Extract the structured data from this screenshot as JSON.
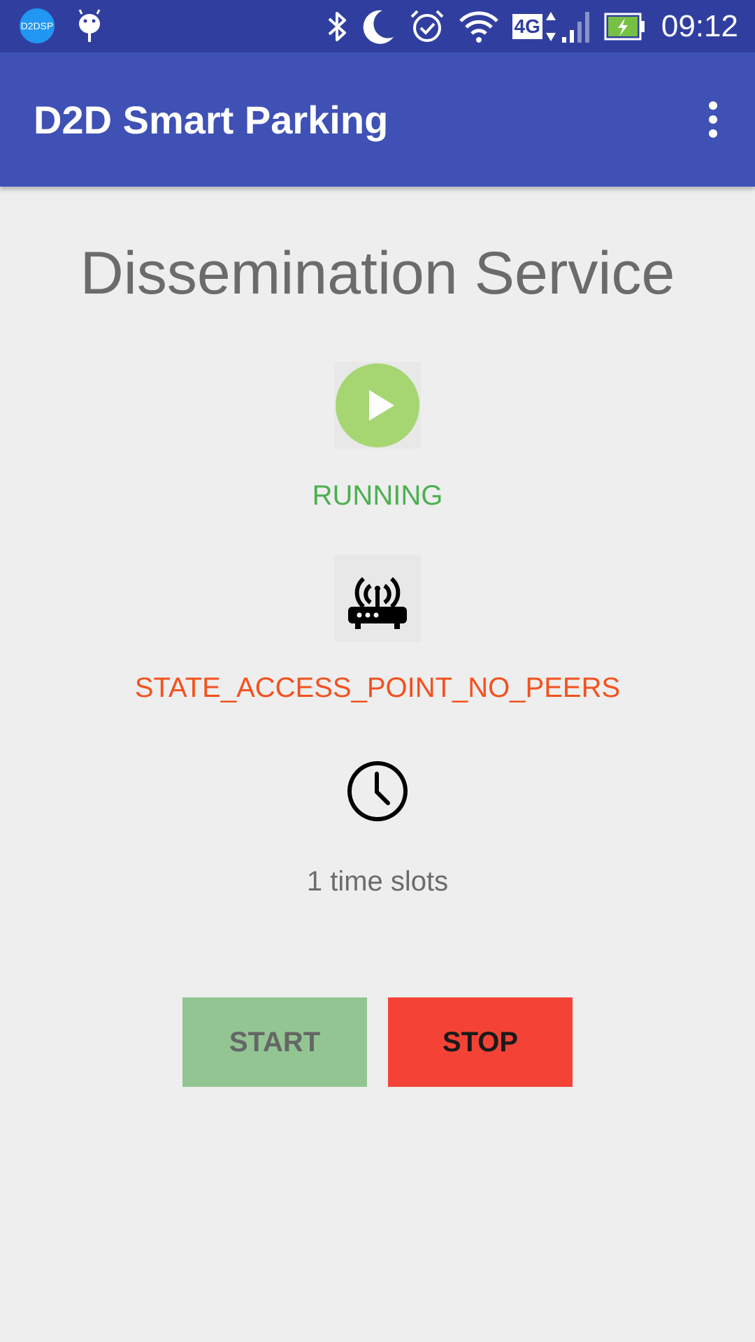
{
  "status_bar": {
    "app_badge": "D2DSP",
    "time": "09:12",
    "network": "4G",
    "icons": [
      "d2dsp-app-icon",
      "android-debug-icon",
      "bluetooth-icon",
      "do-not-disturb-moon-icon",
      "alarm-icon",
      "wifi-icon",
      "signal-icon",
      "battery-charging-icon"
    ]
  },
  "app_bar": {
    "title": "D2D Smart Parking",
    "menu_icon": "more-vert-icon"
  },
  "main": {
    "title": "Dissemination Service",
    "service_status": "RUNNING",
    "connection_state": "STATE_ACCESS_POINT_NO_PEERS",
    "time_slots": "1 time slots",
    "start_label": "START",
    "stop_label": "STOP"
  },
  "colors": {
    "primary_dark": "#303f9f",
    "primary": "#3f51b5",
    "running": "#4caf50",
    "state": "#f4511e",
    "start_button": "#93c593",
    "stop_button": "#f44336"
  }
}
